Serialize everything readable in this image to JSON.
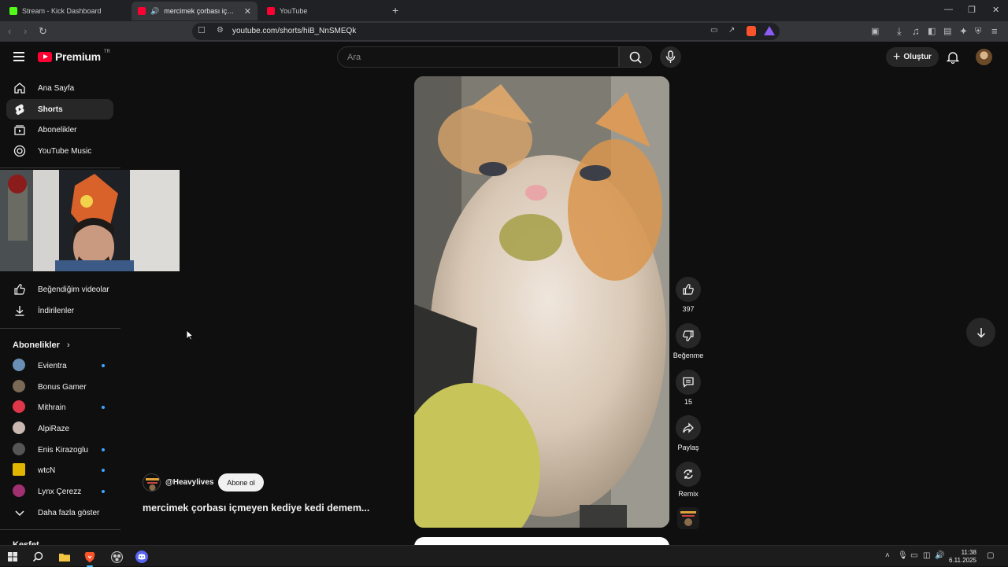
{
  "browser": {
    "tabs": [
      {
        "title": "Stream - Kick Dashboard",
        "favicon_color": "#53fc18"
      },
      {
        "title": "mercimek çorbası içmeyen kedi",
        "favicon_color": "#ff0033"
      },
      {
        "title": "YouTube",
        "favicon_color": "#ff0033"
      }
    ],
    "url": "youtube.com/shorts/hiB_NnSMEQk"
  },
  "header": {
    "logo_text": "Premium",
    "country": "TR",
    "search_placeholder": "Ara",
    "create_label": "Oluştur"
  },
  "sidebar": {
    "main": [
      {
        "label": "Ana Sayfa",
        "icon": "home-icon"
      },
      {
        "label": "Shorts",
        "icon": "shorts-icon"
      },
      {
        "label": "Abonelikler",
        "icon": "subscriptions-icon"
      },
      {
        "label": "YouTube Music",
        "icon": "music-icon"
      }
    ],
    "you": [
      {
        "label": "Beğendiğim videolar",
        "icon": "like-icon"
      },
      {
        "label": "İndirilenler",
        "icon": "download-icon"
      }
    ],
    "subs_title": "Abonelikler",
    "subs": [
      {
        "name": "Evientra",
        "new": true,
        "color": "#6a8fb5"
      },
      {
        "name": "Bonus Gamer",
        "new": false,
        "color": "#7a6a55"
      },
      {
        "name": "Mithrain",
        "new": true,
        "color": "#e0364a"
      },
      {
        "name": "AlpiRaze",
        "new": false,
        "color": "#c9b8b0"
      },
      {
        "name": "Enis Kirazoglu",
        "new": true,
        "color": "#555555"
      },
      {
        "name": "wtcN",
        "new": true,
        "color": "#e2b600"
      },
      {
        "name": "Lynx Çerezz",
        "new": true,
        "color": "#a03070"
      }
    ],
    "show_more": "Daha fazla göster",
    "next_section": "Keşfet"
  },
  "short": {
    "channel": "@Heavylives",
    "subscribe_label": "Abone ol",
    "title": "mercimek çorbası içmeyen kediye kedi demem...",
    "likes": "397",
    "dislike_label": "Beğenme",
    "comments": "15",
    "share_label": "Paylaş",
    "remix_label": "Remix"
  },
  "taskbar": {
    "time": "11:38",
    "date": "6.11.2025"
  }
}
